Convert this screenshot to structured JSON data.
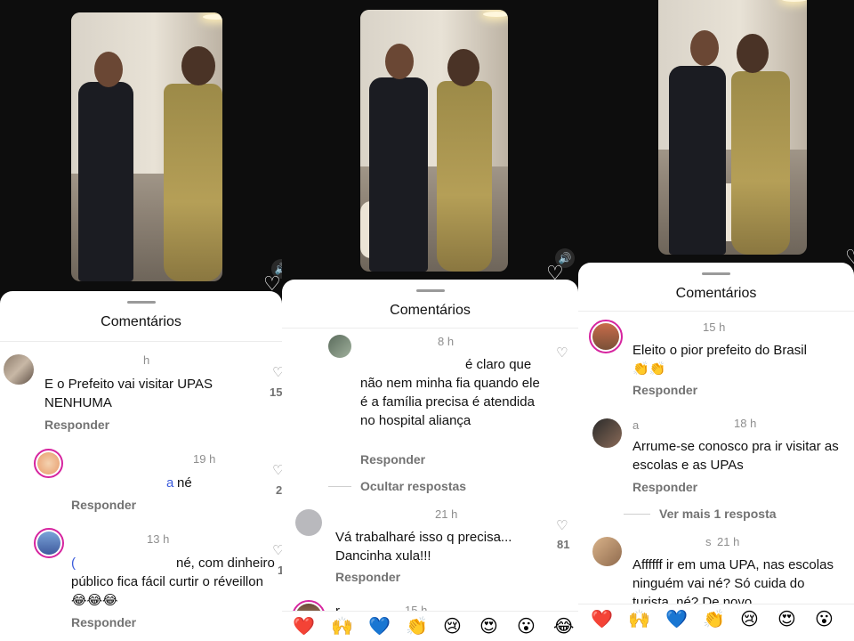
{
  "panels": [
    {
      "sheet_title": "Comentários",
      "comments": [
        {
          "time": "h",
          "text": "E o Prefeito vai visitar UPAS NENHUMA",
          "reply": "Responder",
          "like_count": "15"
        },
        {
          "time": "19 h",
          "text": "né",
          "mention": "a",
          "reply": "Responder",
          "like_count": "2"
        },
        {
          "time": "13 h",
          "text": "né,  com dinheiro público fica fácil curtir o réveillon 😂😂😂",
          "mention": "(",
          "reply": "Responder",
          "like_count": "1"
        }
      ]
    },
    {
      "sheet_title": "Comentários",
      "comments": [
        {
          "time": "8 h",
          "text": "é claro que não nem minha fia quando ele é a família precisa é atendida no hospital aliança",
          "reply": "Responder",
          "hide_replies": "Ocultar respostas"
        },
        {
          "time": "21 h",
          "text": "Vá trabalharé isso q precisa... Dancinha xula!!!",
          "reply": "Responder",
          "like_count": "81"
        },
        {
          "time": "15 h",
          "username_initial": "r"
        }
      ],
      "emojis": [
        "❤️",
        "🙌",
        "💙",
        "👏",
        "😢",
        "😍",
        "😮",
        "😂"
      ]
    },
    {
      "sheet_title": "Comentários",
      "comments": [
        {
          "time": "15 h",
          "text": "Eleito o pior prefeito do Brasil 👏👏",
          "reply": "Responder"
        },
        {
          "time": "18 h",
          "username_initial": "a",
          "text": "Arrume-se conosco pra ir visitar as escolas e as UPAs",
          "reply": "Responder",
          "more_replies": "Ver mais 1 resposta"
        },
        {
          "time": "21 h",
          "username_initial": "s",
          "text": "Affffff ir em uma UPA, nas escolas ninguém vai né? Só cuida do turista, né? De novo"
        }
      ],
      "emojis": [
        "❤️",
        "🙌",
        "💙",
        "👏",
        "😢",
        "😍",
        "😮"
      ]
    }
  ],
  "icons": {
    "like": "heart-outline-icon",
    "sound": "speaker-icon"
  }
}
